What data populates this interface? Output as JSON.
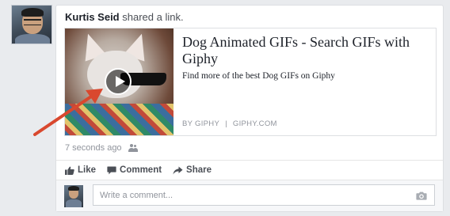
{
  "post": {
    "author": "Kurtis Seid",
    "action_text": " shared a link.",
    "timestamp": "7 seconds ago",
    "privacy_icon": "friends-icon"
  },
  "link_preview": {
    "title": "Dog Animated GIFs - Search GIFs with Giphy",
    "description": "Find more of the best Dog GIFs on Giphy",
    "source_by": "BY GIPHY",
    "source_separator": "|",
    "source_domain": "GIPHY.COM",
    "play_icon": "play-icon"
  },
  "actions": {
    "like_label": "Like",
    "comment_label": "Comment",
    "share_label": "Share"
  },
  "comment_box": {
    "placeholder": "Write a comment...",
    "camera_icon": "camera-icon"
  },
  "colors": {
    "annotation_arrow": "#d9482e",
    "card_background": "#ffffff",
    "page_background": "#e9ebee",
    "meta_text": "#90949c"
  }
}
